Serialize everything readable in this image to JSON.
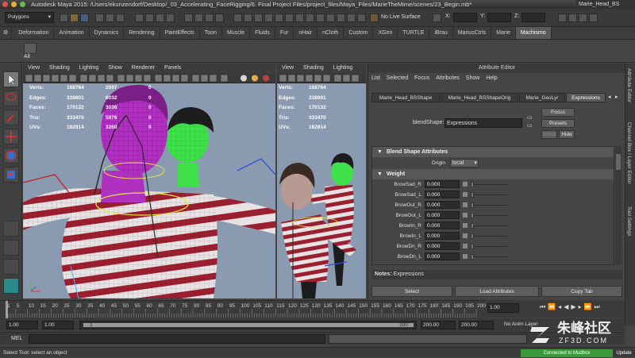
{
  "titlebar": {
    "text": "Autodesk Maya 2015: /Users/ekunzendorf/Desktop/_03_Accelerating_FaceRigging/6. Final Project Files/project_files/Maya_Files/MarieTheMime/scenes/23_Begin.mb*",
    "right_text": "Marie_Head_BS"
  },
  "statusline": {
    "menu_set": "Polygons",
    "live_surface": "No Live Surface"
  },
  "shelf": {
    "tabs": [
      "Deformation",
      "Animation",
      "Dynamics",
      "Rendering",
      "PaintEffects",
      "Toon",
      "Muscle",
      "Fluids",
      "Fur",
      "nHair",
      "nCloth",
      "Custom",
      "XGen",
      "TURTLE",
      "iBrau",
      "MariusCtrls",
      "Marie",
      "Machismo"
    ],
    "active_tab": "Machismo",
    "button_label": "All"
  },
  "viewport_left": {
    "menu": [
      "View",
      "Shading",
      "Lighting",
      "Show",
      "Renderer",
      "Panels"
    ],
    "hud": {
      "labels": [
        "Verts:",
        "Edges:",
        "Faces:",
        "Tris:",
        "UVs:"
      ],
      "col1": [
        "168764",
        "338601",
        "170132",
        "333470",
        "182814"
      ],
      "col2": [
        "2997",
        "6032",
        "3036",
        "5976",
        "3260"
      ],
      "col3": [
        "0",
        "0",
        "0",
        "0",
        "0"
      ]
    }
  },
  "viewport_right": {
    "menu": [
      "View",
      "Shading",
      "Lighting"
    ],
    "hud": {
      "col1": [
        "168764",
        "338601",
        "170132",
        "333470",
        "182814"
      ]
    }
  },
  "attribute_editor": {
    "title": "Attribute Editor",
    "menu": [
      "List",
      "Selected",
      "Focus",
      "Attributes",
      "Show",
      "Help"
    ],
    "node_tabs": [
      "Marie_Head_BSShape",
      "Marie_Head_BSShapeOrig",
      "Marie_GeoLyr",
      "Expressions"
    ],
    "active_tab": "Expressions",
    "node_label": "blendShape:",
    "node_value": "Expressions",
    "focus_label": "Focus",
    "presets_label": "Presets",
    "show_label": "Show",
    "hide_label": "Hide",
    "section_blend": "Blend Shape Attributes",
    "origin_label": "Origin",
    "origin_value": "local",
    "section_weight": "Weight",
    "weights": [
      {
        "name": "BrowSad_R",
        "value": "0.000"
      },
      {
        "name": "BrowSad_L",
        "value": "0.000"
      },
      {
        "name": "BrowOut_R",
        "value": "0.000"
      },
      {
        "name": "BrowOut_L",
        "value": "0.000"
      },
      {
        "name": "BrowIn_R",
        "value": "0.000"
      },
      {
        "name": "BrowIn_L",
        "value": "0.000"
      },
      {
        "name": "BrowDn_R",
        "value": "0.000"
      },
      {
        "name": "BrowDn_L",
        "value": "0.000"
      }
    ],
    "notes_label": "Notes:",
    "notes_value": "Expressions",
    "select_label": "Select",
    "load_label": "Load Attributes",
    "copy_label": "Copy Tab"
  },
  "side_tabs": [
    "Attribute Editor",
    "Channel Box / Layer Editor",
    "Tool Settings"
  ],
  "timeline": {
    "ticks": [
      "1",
      "5",
      "10",
      "15",
      "20",
      "25",
      "30",
      "35",
      "40",
      "45",
      "50",
      "55",
      "60",
      "65",
      "70",
      "75",
      "80",
      "85",
      "90",
      "95",
      "100",
      "105",
      "110",
      "115",
      "120",
      "125",
      "130",
      "135",
      "140",
      "145",
      "150",
      "155",
      "160",
      "165",
      "170",
      "175",
      "180",
      "185",
      "190",
      "195",
      "200"
    ],
    "current": "1.00"
  },
  "range": {
    "start": "1.00",
    "playback_start": "1.00",
    "slider_start": "1",
    "slider_end": "200",
    "playback_end": "200.00",
    "end": "200.00",
    "anim_layer": "No Anim Layer"
  },
  "command": {
    "mel": "MEL"
  },
  "help": {
    "text": "Select Tool: select an object"
  },
  "watermark": {
    "text": "朱峰社区",
    "sub": "ZF3D.COM"
  },
  "status_badges": {
    "mudbox": "Connected to Mudbox",
    "update": "Update"
  },
  "colors": {
    "accent": "#5a5a5a",
    "viewport_bg": "#8a9ab0",
    "selected_mesh": "#b030c0",
    "green_mesh": "#3fe04a",
    "stripe_red": "#9a1f2f"
  }
}
